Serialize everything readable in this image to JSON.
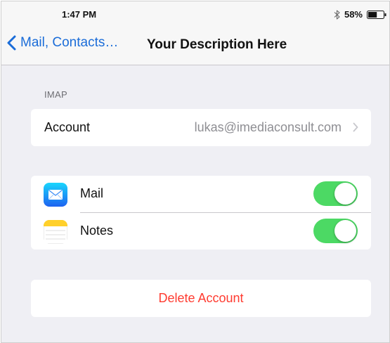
{
  "status_bar": {
    "time": "1:47 PM",
    "battery_percent": "58%",
    "battery_level": 0.58,
    "icons": [
      "bluetooth-icon",
      "battery-icon"
    ]
  },
  "nav": {
    "back_label": "Mail, Contacts…",
    "title": "Your Description Here",
    "back_icon": "chevron-left-icon"
  },
  "section": {
    "header": "IMAP"
  },
  "account_row": {
    "label": "Account",
    "value": "lukas@imediaconsult.com",
    "icon": "chevron-right-icon"
  },
  "sync_items": [
    {
      "label": "Mail",
      "icon": "mail-app-icon",
      "enabled": true
    },
    {
      "label": "Notes",
      "icon": "notes-app-icon",
      "enabled": true
    }
  ],
  "delete_button": {
    "label": "Delete Account"
  },
  "colors": {
    "accent_blue": "#1a6cd8",
    "toggle_on": "#4cd964",
    "destructive_red": "#ff3b30",
    "background": "#efeff4"
  }
}
